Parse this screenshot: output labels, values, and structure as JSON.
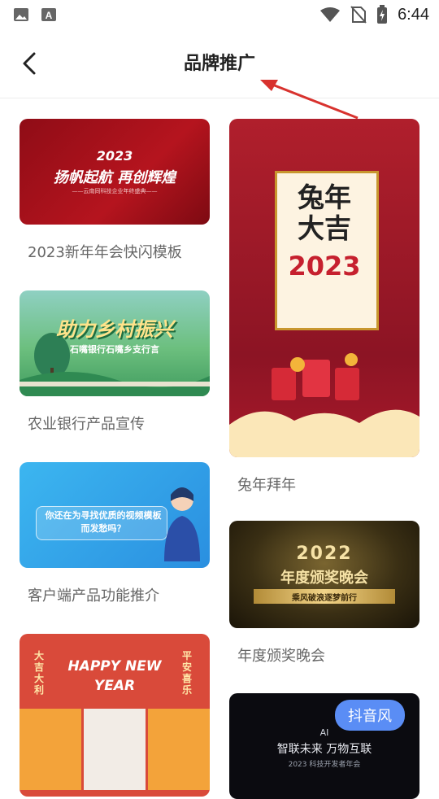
{
  "status_bar": {
    "time": "6:44",
    "icons": [
      "image-icon",
      "text-a-icon",
      "wifi-icon",
      "no-sim-icon",
      "battery-charging-icon"
    ]
  },
  "header": {
    "title": "品牌推广",
    "back_icon": "chevron-left-icon"
  },
  "templates": {
    "left": [
      {
        "label": "2023新年年会快闪模板",
        "thumb_title": "2023",
        "thumb_sub": "扬帆起航  再创辉煌",
        "thumb_small": "——云南同科技企业年终盛典——"
      },
      {
        "label": "农业银行产品宣传",
        "thumb_title": "助力乡村振兴",
        "thumb_sub": "石嘴银行石嘴乡支行言"
      },
      {
        "label": "客户端产品功能推介",
        "thumb_title": "你还在为寻找优质的视频模板而发愁吗？"
      },
      {
        "label": "",
        "thumb_title": "HAPPY NEW YEAR",
        "thumb_left": "大吉大利",
        "thumb_right": "平安喜乐"
      }
    ],
    "right": [
      {
        "label": "兔年拜年",
        "thumb_title": "兔年大吉",
        "thumb_year": "2023"
      },
      {
        "label": "年度颁奖晚会",
        "thumb_title": "2022",
        "thumb_sub": "年度颁奖晚会",
        "thumb_small": "乘风破浪逐梦前行"
      },
      {
        "label": "",
        "badge": "抖音风",
        "thumb_ai": "AI",
        "thumb_title": "智联未来 万物互联",
        "thumb_small": "2023 科技开发者年会"
      }
    ]
  },
  "colors": {
    "accent_blue": "#5a8df5",
    "annotation_red": "#d8322e"
  }
}
